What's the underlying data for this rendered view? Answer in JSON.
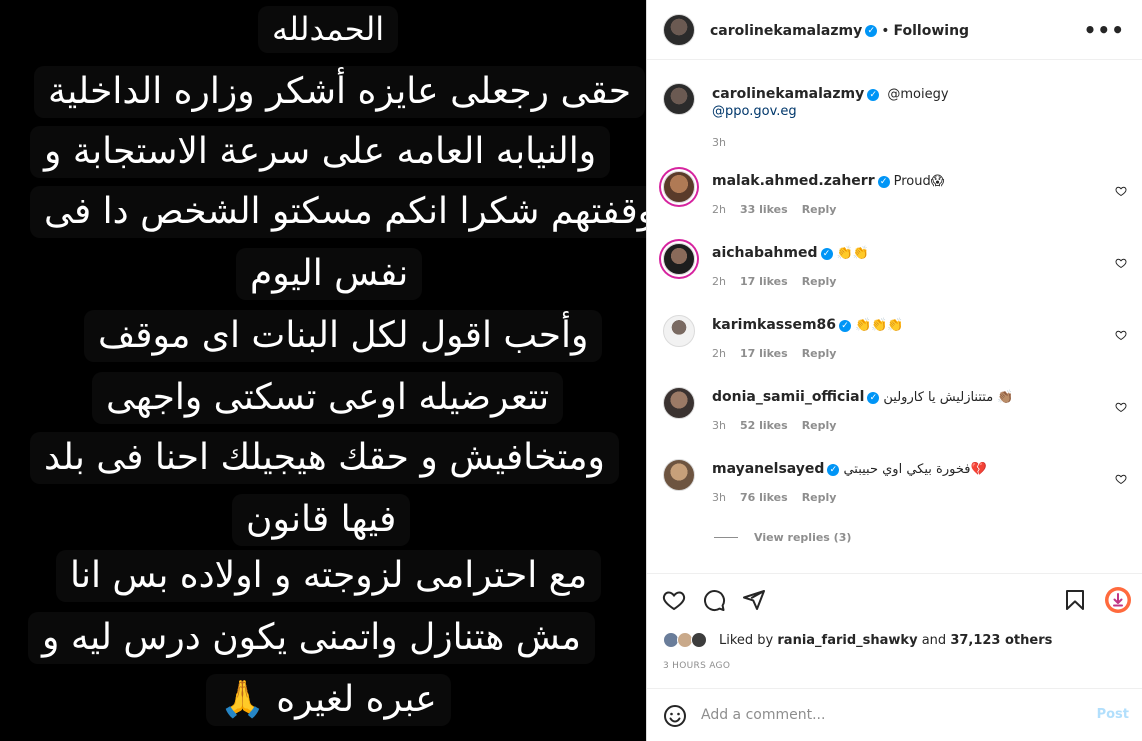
{
  "post": {
    "story_lines": [
      "الحمدلله",
      "حقى رجعلى عايزه أشكر وزاره الداخلية",
      "والنيابه العامه على سرعة الاستجابة و",
      "وقفتهم شكرا انكم مسكتو الشخص دا فى",
      "نفس اليوم",
      "وأحب اقول لكل البنات اى موقف",
      "تتعرضيله اوعى تسكتى واجهى",
      "ومتخافيش و حقك هيجيلك احنا فى بلد",
      "فيها قانون",
      "مع احترامى لزوجته و اولاده بس انا",
      "مش هتنازل واتمنى يكون درس ليه و",
      "عبره لغيره 🙏"
    ]
  },
  "header": {
    "username": "carolinekamalazmy",
    "separator": "•",
    "follow_status": "Following",
    "more_icon": "more-horizontal-icon"
  },
  "caption": {
    "username": "carolinekamalazmy",
    "mention1": "@moiegy",
    "mention2": "@ppo.gov.eg",
    "time": "3h"
  },
  "comments": [
    {
      "username": "malak.ahmed.zaherr",
      "verified": true,
      "text": "Proud😱",
      "time": "2h",
      "likes": "33 likes",
      "reply": "Reply"
    },
    {
      "username": "aichabahmed",
      "verified": true,
      "text": "👏👏",
      "time": "2h",
      "likes": "17 likes",
      "reply": "Reply"
    },
    {
      "username": "karimkassem86",
      "verified": true,
      "text": "👏👏👏",
      "time": "2h",
      "likes": "17 likes",
      "reply": "Reply"
    },
    {
      "username": "donia_samii_official",
      "verified": true,
      "text": "متتنازليش يا كارولين 👏🏽",
      "time": "3h",
      "likes": "52 likes",
      "reply": "Reply"
    },
    {
      "username": "mayanelsayed",
      "verified": true,
      "text": "فخورة بيكي اوي حبيبتي💔",
      "time": "3h",
      "likes": "76 likes",
      "reply": "Reply"
    }
  ],
  "view_replies": "View replies (3)",
  "likes": {
    "prefix": "Liked by",
    "user": "rania_farid_shawky",
    "middle": "and",
    "others": "37,123 others"
  },
  "timestamp": "3 HOURS AGO",
  "composer": {
    "placeholder": "Add a comment...",
    "post_label": "Post"
  },
  "colors": {
    "accent": "#0095f6",
    "link": "#00376b",
    "muted": "#8e8e8e"
  }
}
